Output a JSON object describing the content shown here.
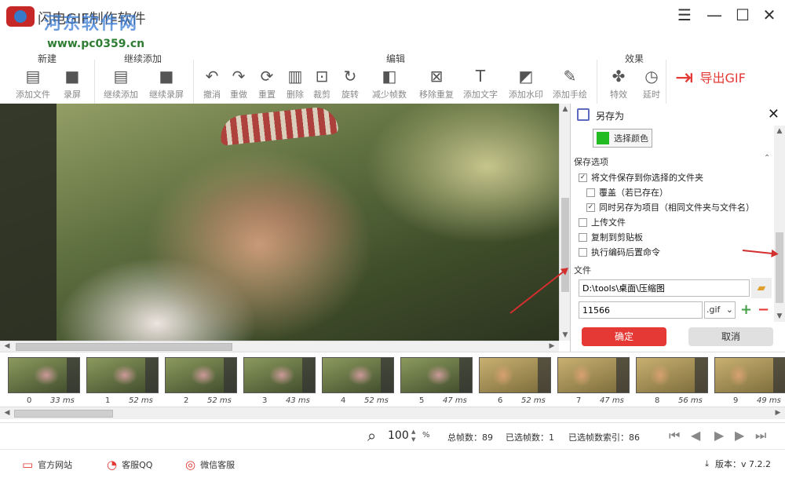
{
  "window": {
    "title": "闪电GIF制作软件",
    "watermark_text": "河东软件网",
    "watermark_url": "www.pc0359.cn",
    "controls": [
      "menu",
      "minimize",
      "maximize",
      "close"
    ]
  },
  "toolbar": {
    "groups": {
      "new": "新建",
      "continue_add": "继续添加",
      "edit": "编辑",
      "effects": "效果"
    },
    "buttons": {
      "add_file": "添加文件",
      "record": "录屏",
      "continue_add": "继续添加",
      "continue_record": "继续录屏",
      "undo": "撤消",
      "redo": "重做",
      "reset": "重置",
      "delete": "删除",
      "crop": "裁剪",
      "rotate": "旋转",
      "reduce_frames": "减少帧数",
      "remove_duplicates": "移除重复",
      "add_text": "添加文字",
      "add_watermark": "添加水印",
      "add_drawing": "添加手绘",
      "effects": "特效",
      "delay": "延时"
    },
    "export": "导出GIF"
  },
  "save_panel": {
    "title": "另存为",
    "color_button": "选择颜色",
    "section_save_options": "保存选项",
    "options": {
      "save_to_folder": "将文件保存到你选择的文件夹",
      "overwrite": "覆盖（若已存在）",
      "save_as_project": "同时另存为项目（相同文件夹与文件名）",
      "upload": "上传文件",
      "copy_clipboard": "复制到剪贴板",
      "run_post_command": "执行编码后置命令"
    },
    "checked": {
      "save_to_folder": true,
      "overwrite": false,
      "save_as_project": true,
      "upload": false,
      "copy_clipboard": false,
      "run_post_command": false
    },
    "section_file": "文件",
    "path": "D:\\tools\\桌面\\压缩图",
    "filename": "11566",
    "extension": ".gif",
    "ok": "确定",
    "cancel": "取消",
    "accent_color": "#e53935"
  },
  "frames": [
    {
      "index": "0",
      "duration": "33 ms",
      "style": "normal"
    },
    {
      "index": "1",
      "duration": "52 ms",
      "style": "normal"
    },
    {
      "index": "2",
      "duration": "52 ms",
      "style": "normal"
    },
    {
      "index": "3",
      "duration": "43 ms",
      "style": "normal"
    },
    {
      "index": "4",
      "duration": "52 ms",
      "style": "normal"
    },
    {
      "index": "5",
      "duration": "47 ms",
      "style": "normal"
    },
    {
      "index": "6",
      "duration": "52 ms",
      "style": "alt"
    },
    {
      "index": "7",
      "duration": "47 ms",
      "style": "alt"
    },
    {
      "index": "8",
      "duration": "56 ms",
      "style": "alt"
    },
    {
      "index": "9",
      "duration": "49 ms",
      "style": "alt"
    }
  ],
  "status": {
    "zoom": "100",
    "zoom_unit": "%",
    "total_frames": "总帧数：89",
    "selected_frames": "已选帧数：1",
    "selected_index": "已选帧数索引：86"
  },
  "footer": {
    "website": "官方网站",
    "qq": "客服QQ",
    "wechat": "微信客服",
    "version": "版本：v 7.2.2"
  }
}
